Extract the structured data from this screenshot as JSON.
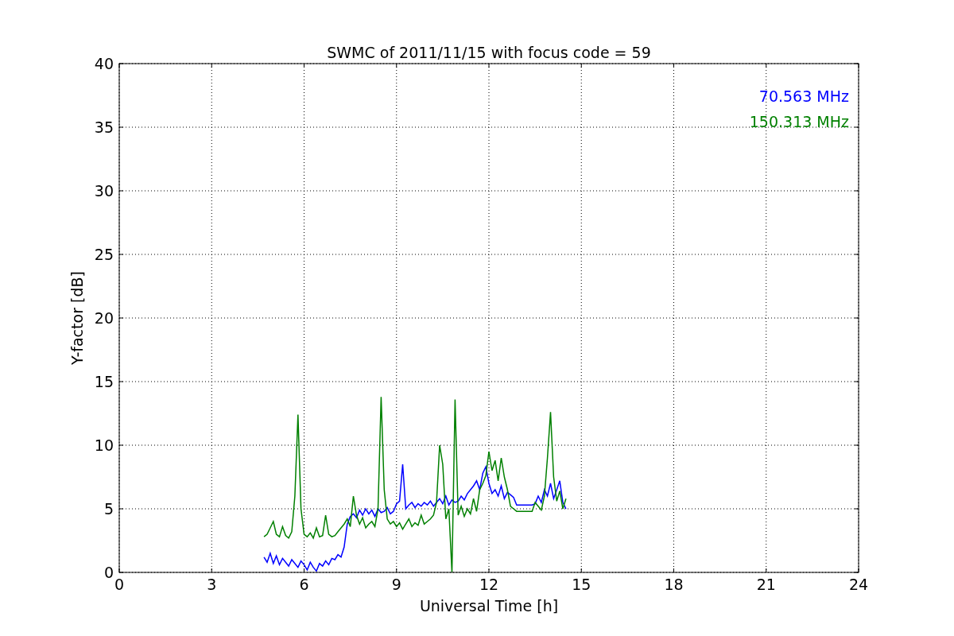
{
  "figure": {
    "chart_data": {
      "type": "line",
      "title": "SWMC of 2011/11/15 with focus code = 59",
      "xlabel": "Universal Time [h]",
      "ylabel": "Y-factor [dB]",
      "xlim": [
        0,
        24
      ],
      "ylim": [
        0,
        40
      ],
      "xticks": [
        0,
        3,
        6,
        9,
        12,
        15,
        18,
        21,
        24
      ],
      "yticks": [
        0,
        5,
        10,
        15,
        20,
        25,
        30,
        35,
        40
      ],
      "grid": true,
      "x": [
        4.7,
        4.8,
        4.9,
        5.0,
        5.1,
        5.2,
        5.3,
        5.4,
        5.5,
        5.6,
        5.7,
        5.8,
        5.9,
        6.0,
        6.1,
        6.2,
        6.3,
        6.4,
        6.5,
        6.6,
        6.7,
        6.8,
        6.9,
        7.0,
        7.1,
        7.2,
        7.3,
        7.4,
        7.5,
        7.6,
        7.7,
        7.8,
        7.9,
        8.0,
        8.1,
        8.2,
        8.3,
        8.4,
        8.5,
        8.6,
        8.7,
        8.8,
        8.9,
        9.0,
        9.1,
        9.2,
        9.3,
        9.4,
        9.5,
        9.6,
        9.7,
        9.8,
        9.9,
        10.0,
        10.1,
        10.2,
        10.3,
        10.4,
        10.5,
        10.6,
        10.7,
        10.8,
        10.9,
        11.0,
        11.1,
        11.2,
        11.3,
        11.4,
        11.5,
        11.6,
        11.7,
        11.8,
        11.9,
        12.0,
        12.1,
        12.2,
        12.3,
        12.4,
        12.5,
        12.6,
        12.7,
        12.8,
        12.9,
        13.0,
        13.1,
        13.2,
        13.3,
        13.4,
        13.5,
        13.6,
        13.7,
        13.8,
        13.9,
        14.0,
        14.1,
        14.2,
        14.3,
        14.4,
        14.5
      ],
      "series": [
        {
          "name": "70.563 MHz",
          "color": "#0000ff",
          "values": [
            1.2,
            0.8,
            1.5,
            0.7,
            1.3,
            0.6,
            1.1,
            0.8,
            0.5,
            1.0,
            0.7,
            0.4,
            0.9,
            0.6,
            0.2,
            0.8,
            0.4,
            0.1,
            0.7,
            0.5,
            0.9,
            0.6,
            1.1,
            1.0,
            1.4,
            1.2,
            2.0,
            3.8,
            4.4,
            4.6,
            4.3,
            4.9,
            4.5,
            5.0,
            4.6,
            4.9,
            4.4,
            5.0,
            4.7,
            4.8,
            5.1,
            4.6,
            4.8,
            5.4,
            5.6,
            8.5,
            5.0,
            5.3,
            5.5,
            5.1,
            5.4,
            5.2,
            5.5,
            5.3,
            5.6,
            5.2,
            5.5,
            5.8,
            5.4,
            6.0,
            5.3,
            5.7,
            5.5,
            5.6,
            6.0,
            5.7,
            6.2,
            6.5,
            6.8,
            7.2,
            6.5,
            7.8,
            8.3,
            7.0,
            6.2,
            6.5,
            6.0,
            6.8,
            5.8,
            6.3,
            6.1,
            5.9,
            5.3,
            5.3,
            5.3,
            5.3,
            5.3,
            5.3,
            5.4,
            6.0,
            5.5,
            6.5,
            6.0,
            7.0,
            5.8,
            6.5,
            7.2,
            5.5,
            5.0
          ]
        },
        {
          "name": "150.313 MHz",
          "color": "#008000",
          "values": [
            2.8,
            3.0,
            3.5,
            4.0,
            3.0,
            2.8,
            3.6,
            2.9,
            2.7,
            3.2,
            6.0,
            12.4,
            5.0,
            3.0,
            2.8,
            3.1,
            2.7,
            3.5,
            2.8,
            2.9,
            4.5,
            3.0,
            2.8,
            2.9,
            3.2,
            3.5,
            3.8,
            4.2,
            3.6,
            6.0,
            4.5,
            3.8,
            4.3,
            3.5,
            3.8,
            4.0,
            3.6,
            5.0,
            13.8,
            6.5,
            4.2,
            3.8,
            4.0,
            3.6,
            3.9,
            3.4,
            3.8,
            4.2,
            3.6,
            3.9,
            3.7,
            4.5,
            3.8,
            4.0,
            4.2,
            4.5,
            5.5,
            10.0,
            8.5,
            4.2,
            5.0,
            0.0,
            13.6,
            4.5,
            5.2,
            4.4,
            5.0,
            4.6,
            5.8,
            4.8,
            6.5,
            7.0,
            7.6,
            9.5,
            8.0,
            8.8,
            7.2,
            9.0,
            7.5,
            6.5,
            5.2,
            5.0,
            4.8,
            4.8,
            4.8,
            4.8,
            4.8,
            4.8,
            5.5,
            5.2,
            4.9,
            6.0,
            9.0,
            12.6,
            7.5,
            5.6,
            6.4,
            5.0,
            5.8
          ]
        }
      ]
    }
  }
}
